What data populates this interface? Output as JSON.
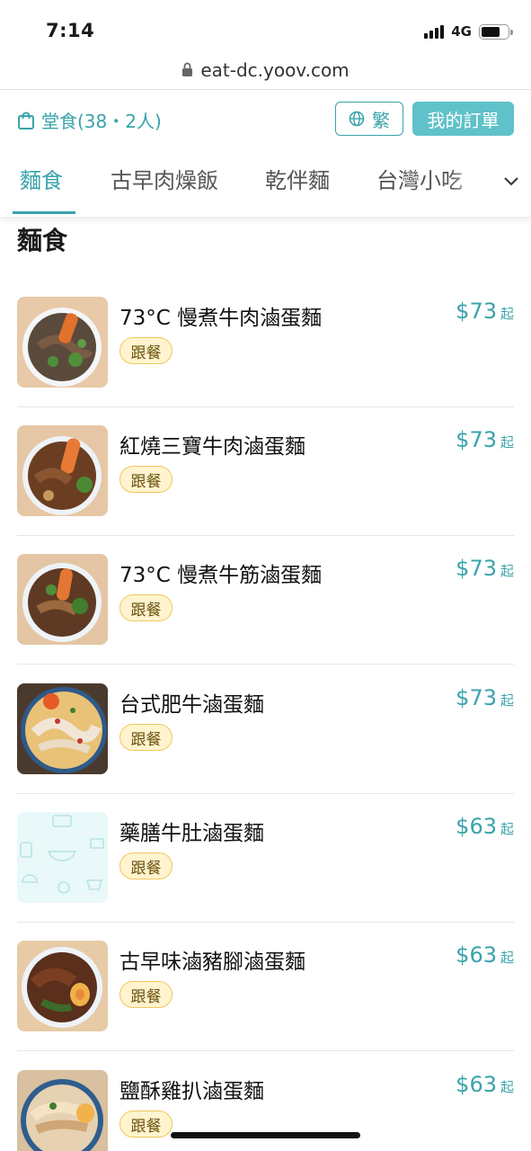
{
  "status_bar": {
    "time": "7:14",
    "network": "4G"
  },
  "browser": {
    "url": "eat-dc.yoov.com"
  },
  "header": {
    "dine_mode": "堂食(38・2人)",
    "language_button": "繁",
    "orders_button": "我的訂單"
  },
  "tabs": [
    {
      "label": "麵食",
      "active": true
    },
    {
      "label": "古早肉燥飯",
      "active": false
    },
    {
      "label": "乾伴麵",
      "active": false
    },
    {
      "label": "台灣小吃",
      "active": false
    }
  ],
  "section": {
    "title": "麵食"
  },
  "items": [
    {
      "name": "73°C 慢煮牛肉滷蛋麵",
      "badge": "跟餐",
      "price": "$73",
      "price_suffix": "起",
      "image": "beef-noodle-photo"
    },
    {
      "name": "紅燒三寶牛肉滷蛋麵",
      "badge": "跟餐",
      "price": "$73",
      "price_suffix": "起",
      "image": "braised-beef-noodle-photo"
    },
    {
      "name": "73°C 慢煮牛筋滷蛋麵",
      "badge": "跟餐",
      "price": "$73",
      "price_suffix": "起",
      "image": "beef-tendon-noodle-photo"
    },
    {
      "name": "台式肥牛滷蛋麵",
      "badge": "跟餐",
      "price": "$73",
      "price_suffix": "起",
      "image": "fatty-beef-noodle-photo"
    },
    {
      "name": "藥膳牛肚滷蛋麵",
      "badge": "跟餐",
      "price": "$63",
      "price_suffix": "起",
      "image": "placeholder-food-pattern"
    },
    {
      "name": "古早味滷豬腳滷蛋麵",
      "badge": "跟餐",
      "price": "$63",
      "price_suffix": "起",
      "image": "pork-knuckle-noodle-photo"
    },
    {
      "name": "鹽酥雞扒滷蛋麵",
      "badge": "跟餐",
      "price": "$63",
      "price_suffix": "起",
      "image": "chicken-cutlet-noodle-photo"
    }
  ],
  "colors": {
    "accent": "#3aa3ab",
    "accent_fill": "#5fc1c9",
    "badge_bg": "#fff4cf",
    "badge_border": "#f0c75e"
  }
}
